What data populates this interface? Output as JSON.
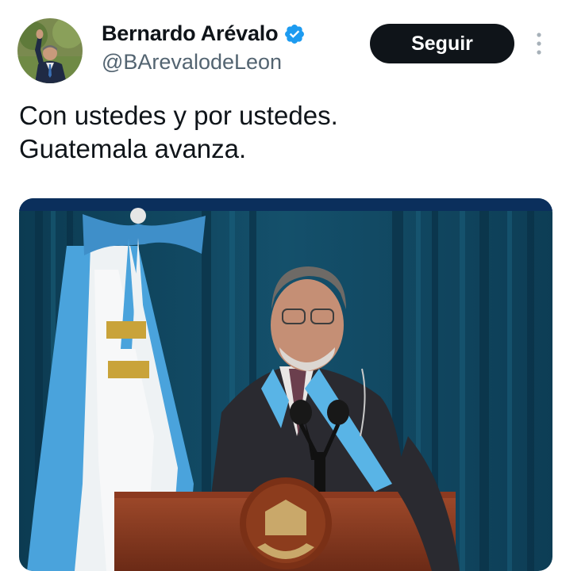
{
  "author": {
    "name": "Bernardo Arévalo",
    "handle": "@BArevalodeLeon",
    "verified": true,
    "avatar_alt": "avatar"
  },
  "actions": {
    "follow_label": "Seguir",
    "more_icon": "more-vertical-icon"
  },
  "tweet": {
    "text": "Con ustedes y por ustedes.\nGuatemala avanza."
  },
  "media": {
    "type": "photo"
  },
  "colors": {
    "text": "#0f1419",
    "secondary": "#536471",
    "verified_badge": "#1d9bf0",
    "follow_bg": "#0f1419"
  }
}
